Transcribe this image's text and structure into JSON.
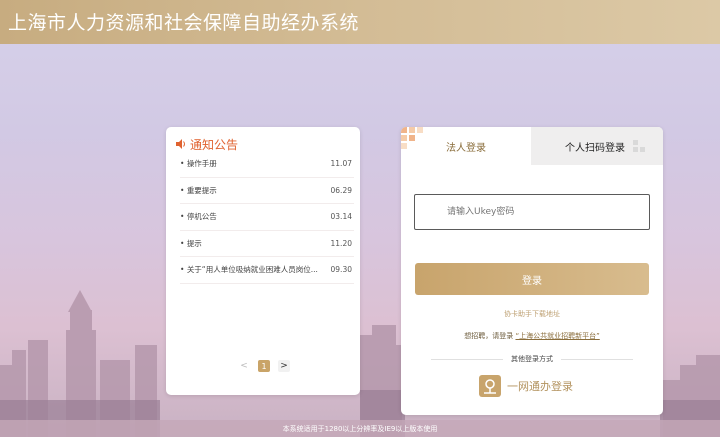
{
  "header": {
    "title": "上海市人力资源和社会保障自助经办系统"
  },
  "notice": {
    "title": "通知公告",
    "items": [
      {
        "name": "操作手册",
        "date": "11.07"
      },
      {
        "name": "重要提示",
        "date": "06.29"
      },
      {
        "name": "停机公告",
        "date": "03.14"
      },
      {
        "name": "提示",
        "date": "11.20"
      },
      {
        "name": "关于“用人单位吸纳就业困难人员岗位...",
        "date": "09.30"
      }
    ],
    "pager": {
      "prev": "<",
      "current": "1",
      "next": ">"
    }
  },
  "login": {
    "tab_active": "法人登录",
    "tab_inactive": "个人扫码登录",
    "ukey_placeholder": "请输入Ukey密码",
    "login_button": "登录",
    "helper_link": "协卡助手下载地址",
    "hint_prefix": "想招聘，请登录",
    "hint_link": "“上海公共就业招聘新平台”",
    "other_methods": "其他登录方式",
    "yiwang_label": "一网通办登录"
  },
  "footer": {
    "text": "本系统适用于1280以上分辨率及IE9以上版本使用"
  },
  "colors": {
    "accent": "#c9a468",
    "header": "#cdb48a",
    "notice_title": "#e0622f"
  }
}
